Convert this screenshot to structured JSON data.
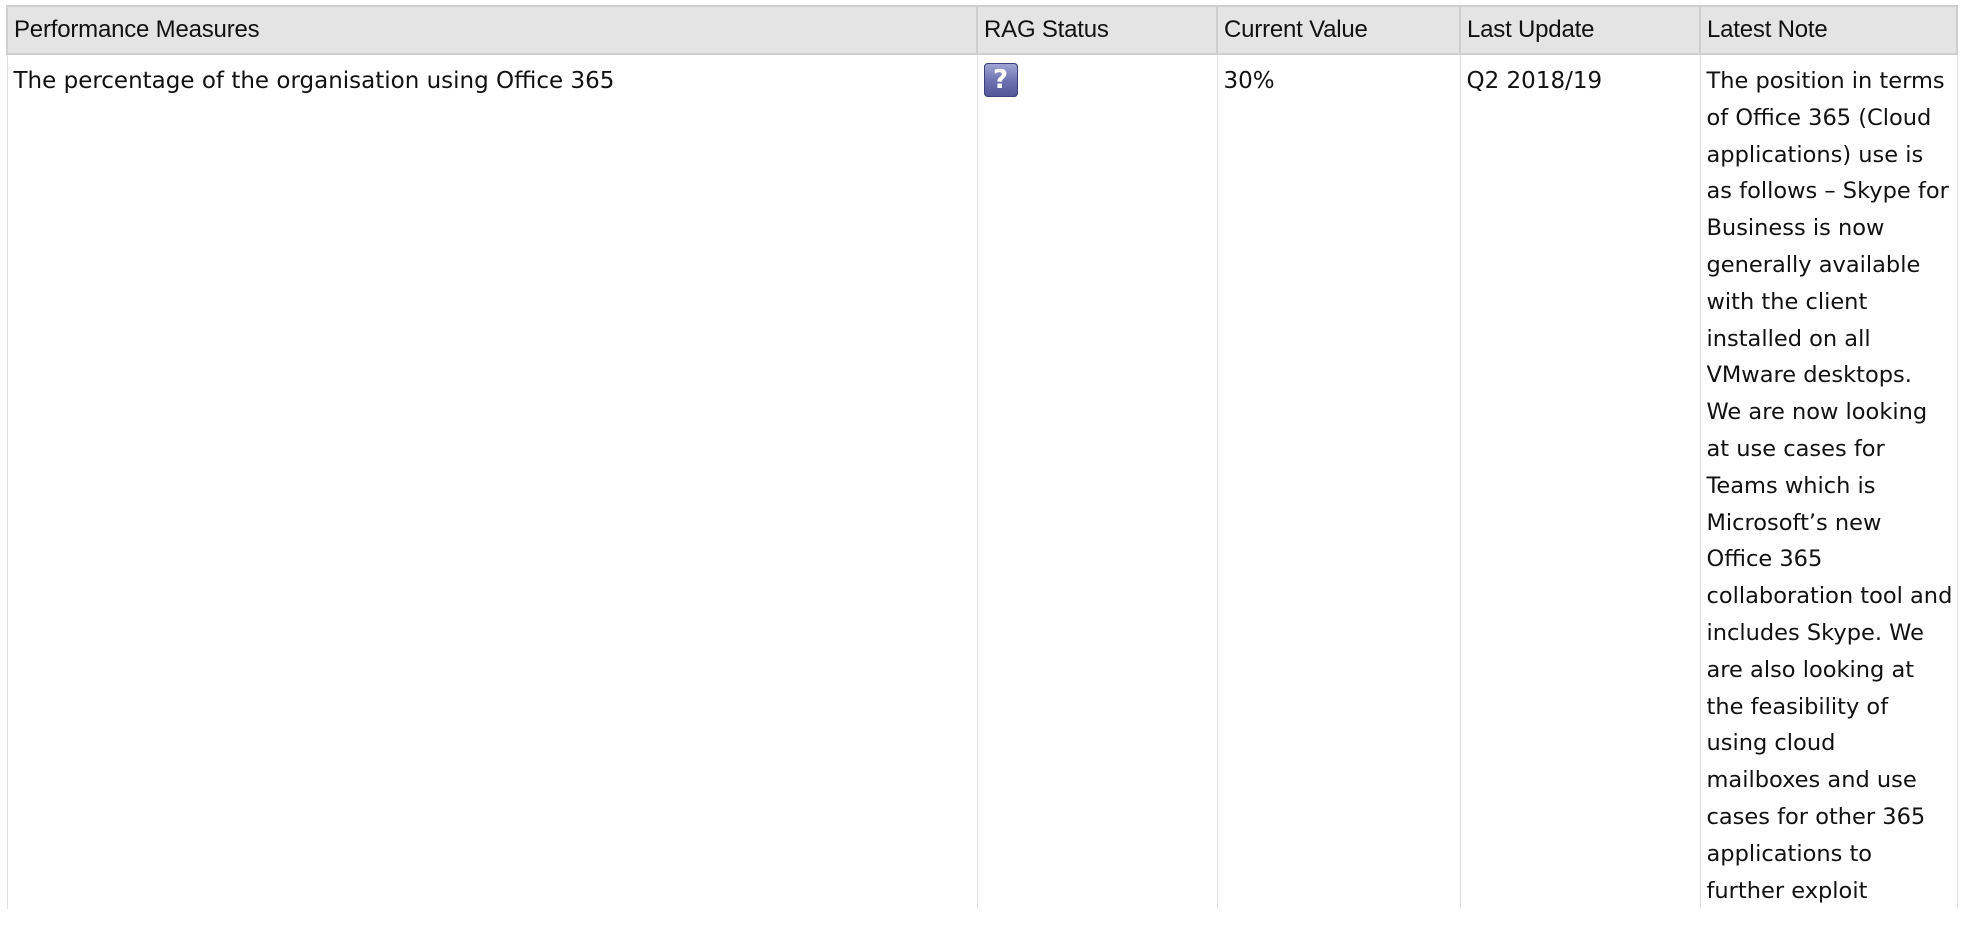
{
  "table": {
    "headers": {
      "measure": "Performance Measures",
      "rag": "RAG Status",
      "current": "Current Value",
      "updated": "Last Update",
      "note": "Latest Note"
    },
    "rows": [
      {
        "measure": "The percentage of the organisation using Office 365",
        "rag_icon": "question-icon",
        "rag_glyph": "?",
        "current": "30%",
        "updated": "Q2 2018/19",
        "note": "The position in terms of Office 365 (Cloud applications) use is as follows – Skype for Business is now generally available with the client installed on all VMware desktops. We are now looking at use cases for Teams which is Microsoft’s new Office 365 collaboration tool and includes Skype. We are also looking at the feasibility of using cloud mailboxes and use cases for other 365 applications to further exploit"
      }
    ]
  },
  "colors": {
    "header_bg": "#e4e4e4",
    "header_border": "#cfcfcf",
    "rag_unknown": "#6f74b3"
  }
}
